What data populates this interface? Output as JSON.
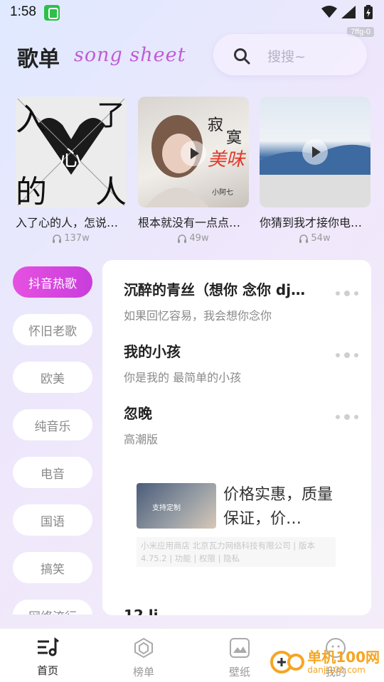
{
  "status": {
    "time": "1:58",
    "badge": "7ffg-0"
  },
  "header": {
    "title": "歌单",
    "subtitle_script": "song sheet",
    "search_placeholder": "搜搜~"
  },
  "playlists": [
    {
      "title": "入了心的人，怎说…",
      "count": "137w"
    },
    {
      "title": "根本就没有一点点…",
      "count": "49w"
    },
    {
      "title": "你猜到我才接你电…",
      "count": "54w"
    }
  ],
  "cover_text": {
    "c1_top": "入",
    "c1_topright": "了",
    "c1_mid": "心",
    "c1_bl": "的",
    "c1_br": "人",
    "c2_a": "寂",
    "c2_b": "寞",
    "c2_red": "美味",
    "c2_artist": "小阿七"
  },
  "categories": [
    "抖音热歌",
    "怀旧老歌",
    "欧美",
    "纯音乐",
    "电音",
    "国语",
    "搞笑",
    "网络流行"
  ],
  "songs": [
    {
      "title": "沉醉的青丝（想你 念你 dj…",
      "sub": "如果回忆容易，我会想你念你"
    },
    {
      "title": "我的小孩",
      "sub": "你是我的 最简单的小孩"
    },
    {
      "title": "忽晚",
      "sub": "高潮版"
    }
  ],
  "ad": {
    "text": "价格实惠，质量保证，价…",
    "info": "小米应用商店 北京瓦力网络科技有限公司 | 版本 4.75.2 | 功能 | 权限 | 隐私",
    "img_text": "支持定制"
  },
  "cutoff_title": "12 li",
  "nav": [
    {
      "label": "首页",
      "active": true
    },
    {
      "label": "榜单",
      "active": false
    },
    {
      "label": "壁纸",
      "active": false
    },
    {
      "label": "我的",
      "active": false
    }
  ],
  "watermark": {
    "line1": "单机100网",
    "line2": "danji100.com"
  },
  "colors": {
    "accent": "#d948dd",
    "accent_script": "#c05bd6"
  }
}
